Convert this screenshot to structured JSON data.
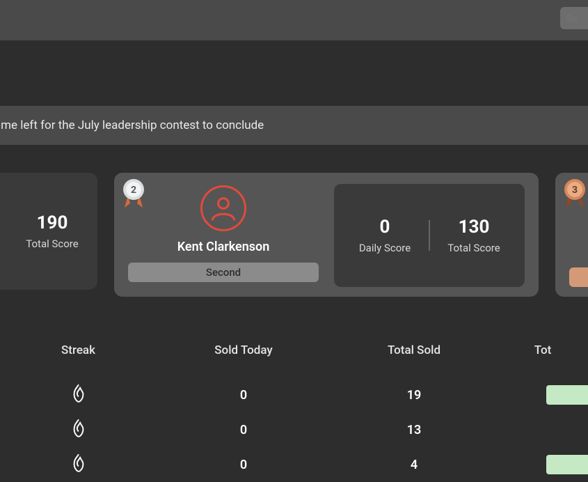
{
  "search": {
    "placeholder": "Se"
  },
  "banner": {
    "text": "ime left for the July leadership contest to conclude"
  },
  "cards": {
    "first": {
      "total_score": "190",
      "total_score_label": "Total Score"
    },
    "featured": {
      "medal_rank": "2",
      "name": "Kent Clarkenson",
      "rank_label": "Second",
      "daily_score": "0",
      "daily_score_label": "Daily Score",
      "total_score": "130",
      "total_score_label": "Total Score"
    },
    "third": {
      "medal_rank": "3"
    }
  },
  "table": {
    "headers": {
      "streak": "Streak",
      "sold_today": "Sold Today",
      "total_sold": "Total Sold",
      "tot": "Tot"
    },
    "rows": [
      {
        "sold_today": "0",
        "total_sold": "19"
      },
      {
        "sold_today": "0",
        "total_sold": "13"
      },
      {
        "sold_today": "0",
        "total_sold": "4"
      }
    ]
  }
}
